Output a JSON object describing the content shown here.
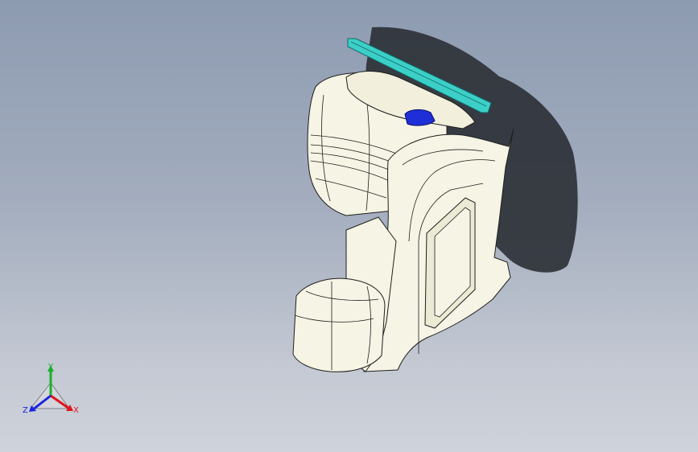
{
  "viewport": {
    "background_top": "#8d9bb1",
    "background_bottom": "#cfd3db"
  },
  "model": {
    "body_color": "#f6f4e4",
    "shade_color": "#ecead4",
    "edge_color": "#1e1e1e",
    "rail_color": "#3ccfc8",
    "handle_color": "#1f2fd8",
    "shadow_color": "#2e3238"
  },
  "triad": {
    "x_label": "X",
    "y_label": "Y",
    "z_label": "Z",
    "x_color": "#e0141b",
    "y_color": "#1bb02a",
    "z_color": "#1b24e0"
  }
}
